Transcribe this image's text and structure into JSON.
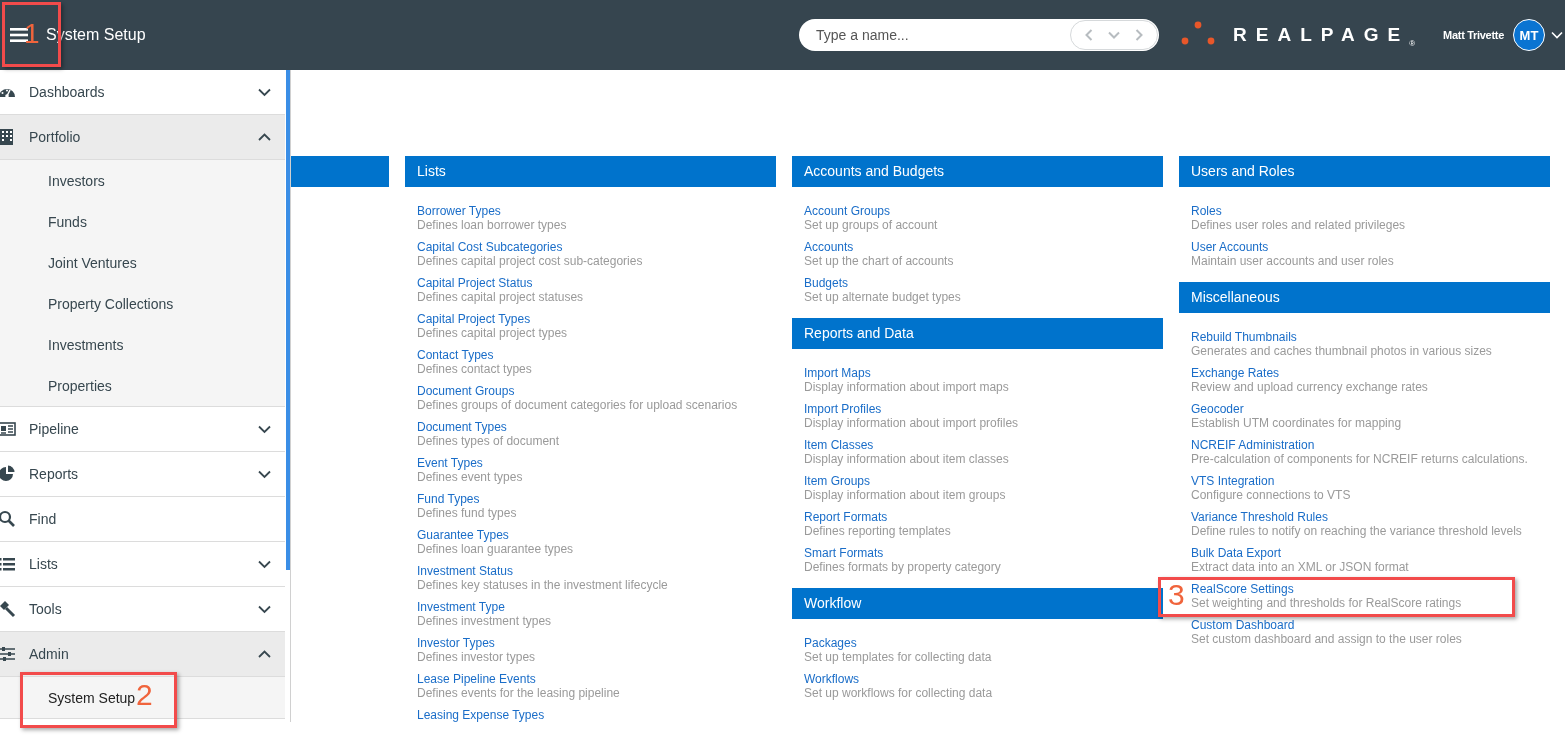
{
  "topbar": {
    "title": "System Setup",
    "search": {
      "placeholder": "Type a name..."
    },
    "logo": {
      "text": "REALPAGE",
      "mark": "®"
    },
    "user": {
      "name": "Matt Trivette",
      "initials": "MT"
    }
  },
  "sidebar": {
    "items": [
      {
        "label": "Dashboards",
        "expanded": false
      },
      {
        "label": "Portfolio",
        "expanded": true,
        "children": [
          {
            "label": "Investors",
            "selected": false
          },
          {
            "label": "Funds",
            "selected": false
          },
          {
            "label": "Joint Ventures",
            "selected": false
          },
          {
            "label": "Property Collections",
            "selected": false
          },
          {
            "label": "Investments",
            "selected": false
          },
          {
            "label": "Properties",
            "selected": false
          }
        ]
      },
      {
        "label": "Pipeline",
        "expanded": false
      },
      {
        "label": "Reports",
        "expanded": false
      },
      {
        "label": "Find"
      },
      {
        "label": "Lists",
        "expanded": false
      },
      {
        "label": "Tools",
        "expanded": false
      },
      {
        "label": "Admin",
        "expanded": true,
        "children": [
          {
            "label": "System Setup",
            "selected": true
          }
        ]
      }
    ]
  },
  "columns": [
    {
      "sections": [
        {
          "title": "Lists",
          "items": [
            {
              "link": "Borrower Types",
              "description": "Defines loan borrower types"
            },
            {
              "link": "Capital Cost Subcategories",
              "description": "Defines capital project cost sub-categories"
            },
            {
              "link": "Capital Project Status",
              "description": "Defines capital project statuses"
            },
            {
              "link": "Capital Project Types",
              "description": "Defines capital project types"
            },
            {
              "link": "Contact Types",
              "description": "Defines contact types"
            },
            {
              "link": "Document Groups",
              "description": "Defines groups of document categories for upload scenarios"
            },
            {
              "link": "Document Types",
              "description": "Defines types of document"
            },
            {
              "link": "Event Types",
              "description": "Defines event types"
            },
            {
              "link": "Fund Types",
              "description": "Defines fund types"
            },
            {
              "link": "Guarantee Types",
              "description": "Defines loan guarantee types"
            },
            {
              "link": "Investment Status",
              "description": "Defines key statuses in the investment lifecycle"
            },
            {
              "link": "Investment Type",
              "description": "Defines investment types"
            },
            {
              "link": "Investor Types",
              "description": "Defines investor types"
            },
            {
              "link": "Lease Pipeline Events",
              "description": "Defines events for the leasing pipeline"
            },
            {
              "link": "Leasing Expense Types"
            }
          ]
        }
      ]
    },
    {
      "sections": [
        {
          "title": "Accounts and Budgets",
          "items": [
            {
              "link": "Account Groups",
              "description": "Set up groups of account"
            },
            {
              "link": "Accounts",
              "description": "Set up the chart of accounts"
            },
            {
              "link": "Budgets",
              "description": "Set up alternate budget types"
            }
          ]
        },
        {
          "title": "Reports and Data",
          "items": [
            {
              "link": "Import Maps",
              "description": "Display information about import maps"
            },
            {
              "link": "Import Profiles",
              "description": "Display information about import profiles"
            },
            {
              "link": "Item Classes",
              "description": "Display information about item classes"
            },
            {
              "link": "Item Groups",
              "description": "Display information about item groups"
            },
            {
              "link": "Report Formats",
              "description": "Defines reporting templates"
            },
            {
              "link": "Smart Formats",
              "description": "Defines formats by property category"
            }
          ]
        },
        {
          "title": "Workflow",
          "items": [
            {
              "link": "Packages",
              "description": "Set up templates for collecting data"
            },
            {
              "link": "Workflows",
              "description": "Set up workflows for collecting data"
            }
          ]
        }
      ]
    },
    {
      "sections": [
        {
          "title": "Users and Roles",
          "items": [
            {
              "link": "Roles",
              "description": "Defines user roles and related privileges"
            },
            {
              "link": "User Accounts",
              "description": "Maintain user accounts and user roles"
            }
          ]
        },
        {
          "title": "Miscellaneous",
          "items": [
            {
              "link": "Rebuild Thumbnails",
              "description": "Generates and caches thumbnail photos in various sizes"
            },
            {
              "link": "Exchange Rates",
              "description": "Review and upload currency exchange rates"
            },
            {
              "link": "Geocoder",
              "description": "Establish UTM coordinates for mapping"
            },
            {
              "link": "NCREIF Administration",
              "description": "Pre-calculation of components for NCREIF returns calculations."
            },
            {
              "link": "VTS Integration",
              "description": "Configure connections to VTS"
            },
            {
              "link": "Variance Threshold Rules",
              "description": "Define rules to notify on reaching the variance threshold levels"
            },
            {
              "link": "Bulk Data Export",
              "description": "Extract data into an XML or JSON format"
            },
            {
              "link": "RealScore Settings",
              "description": "Set weighting and thresholds for RealScore ratings"
            },
            {
              "link": "Custom Dashboard",
              "description": "Set custom dashboard and assign to the user roles"
            }
          ]
        }
      ]
    }
  ],
  "callouts": [
    {
      "number": "1"
    },
    {
      "number": "2"
    },
    {
      "number": "3"
    }
  ]
}
